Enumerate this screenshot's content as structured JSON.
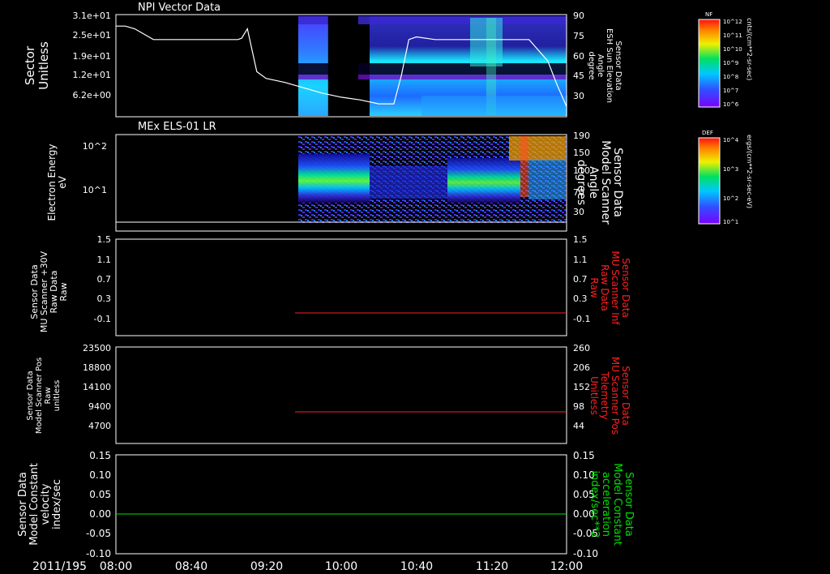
{
  "figure": {
    "date_label": "2011/195",
    "time_ticks": [
      "08:00",
      "08:40",
      "09:20",
      "10:00",
      "10:40",
      "11:20",
      "12:00"
    ],
    "time_range_minutes": [
      480,
      720
    ]
  },
  "colorbars": [
    {
      "tag": "NF",
      "unit": "cnts/(cm**2-sr-sec)",
      "ticks": [
        "10^12",
        "10^11",
        "10^10",
        "10^9",
        "10^8",
        "10^7",
        "10^6"
      ]
    },
    {
      "tag": "DEF",
      "unit": "ergs/(cm**2-sr-sec-eV)",
      "ticks": [
        "10^4",
        "10^3",
        "10^2",
        "10^1"
      ]
    }
  ],
  "colors": {
    "white": "#ffffff",
    "red": "#ff2020",
    "green": "#00e000",
    "background": "#000000"
  },
  "chart_data": [
    {
      "type": "heatmap",
      "title": "NPI Vector Data",
      "ylabel_left": [
        "Sector",
        "Unitless"
      ],
      "yticks_left": [
        "3.1e+01",
        "2.5e+01",
        "1.9e+01",
        "1.2e+01",
        "6.2e+00"
      ],
      "ylabel_right": [
        "Sensor Data",
        "ESH Sun Elevation",
        "Angle",
        "degree"
      ],
      "yticks_right": [
        "90",
        "75",
        "60",
        "45",
        "30"
      ],
      "ylim_right": [
        15,
        90
      ],
      "line_series": {
        "name": "ESH Sun Elevation Angle",
        "color": "#ffffff",
        "x": [
          480,
          485,
          490,
          500,
          520,
          545,
          547,
          550,
          555,
          560,
          570,
          580,
          590,
          600,
          610,
          620,
          628,
          632,
          636,
          640,
          650,
          660,
          670,
          680,
          690,
          700,
          710,
          715,
          720
        ],
        "y": [
          82,
          82,
          80,
          72,
          72,
          72,
          73,
          80,
          48,
          43,
          40,
          36,
          32,
          29,
          27,
          24,
          24,
          45,
          72,
          74,
          72,
          72,
          72,
          72,
          72,
          72,
          56,
          38,
          22
        ]
      },
      "data_gaps_minutes": [
        [
          480,
          559
        ],
        [
          593,
          609
        ]
      ]
    },
    {
      "type": "heatmap",
      "title": "MEx ELS-01 LR",
      "ylabel_left": [
        "Electron Energy",
        "eV"
      ],
      "yticks_left": [
        "10^2",
        "10^1"
      ],
      "ylabel_right": [
        "Sensor Data",
        "Model Scanner",
        "Angle",
        "degrees"
      ],
      "yticks_right": [
        "190",
        "150",
        "110",
        "70",
        "30"
      ],
      "line_series": {
        "name": "Model Scanner Angle",
        "color": "#ffffff",
        "x": [
          480,
          720
        ],
        "y": [
          10,
          10
        ]
      },
      "data_gaps_minutes": [
        [
          480,
          560
        ]
      ]
    },
    {
      "type": "line",
      "ylabel_left": [
        "Sensor Data",
        "MU Scanner +30V",
        "Raw Data",
        "Raw"
      ],
      "yticks_left": [
        "1.5",
        "1.1",
        "0.7",
        "0.3",
        "-0.1"
      ],
      "ylim": [
        -0.3,
        1.5
      ],
      "ylabel_right": [
        "Sensor Data",
        "MU Scanner Inf",
        "Raw Data",
        "Raw"
      ],
      "yticks_right": [
        "1.5",
        "1.1",
        "0.7",
        "0.3",
        "-0.1"
      ],
      "series": [
        {
          "name": "MU Scanner Inf Raw Data",
          "color": "#ff2020",
          "x": [
            560,
            720
          ],
          "y": [
            0.0,
            0.0
          ]
        }
      ]
    },
    {
      "type": "line",
      "ylabel_left": [
        "Sensor Data",
        "Model Scanner Pos",
        "Raw",
        "unitless"
      ],
      "yticks_left": [
        "23500",
        "18800",
        "14100",
        "9400",
        "4700"
      ],
      "ylim": [
        0,
        23500
      ],
      "ylabel_right": [
        "Sensor Data",
        "MU Scanner Pos",
        "Telemetry",
        "Unitless"
      ],
      "yticks_right": [
        "260",
        "206",
        "152",
        "98",
        "44"
      ],
      "ylim_right": [
        0,
        260
      ],
      "series": [
        {
          "name": "MU Scanner Pos Telemetry",
          "color": "#ff2020",
          "x": [
            560,
            720
          ],
          "y": [
            87,
            87
          ]
        }
      ]
    },
    {
      "type": "line",
      "ylabel_left": [
        "Sensor Data",
        "Model Constant",
        "velocity",
        "index/sec"
      ],
      "yticks_left": [
        "0.15",
        "0.10",
        "0.05",
        "0.00",
        "-0.05",
        "-0.10"
      ],
      "ylim": [
        -0.1,
        0.15
      ],
      "ylabel_right": [
        "Sensor Data",
        "Model Constant",
        "acceleration",
        "index/sec**2"
      ],
      "yticks_right": [
        "0.15",
        "0.10",
        "0.05",
        "0.00",
        "-0.05",
        "-0.10"
      ],
      "series": [
        {
          "name": "Model Constant acceleration",
          "color": "#00e000",
          "x": [
            480,
            720
          ],
          "y": [
            0.0,
            0.0
          ]
        }
      ]
    }
  ]
}
